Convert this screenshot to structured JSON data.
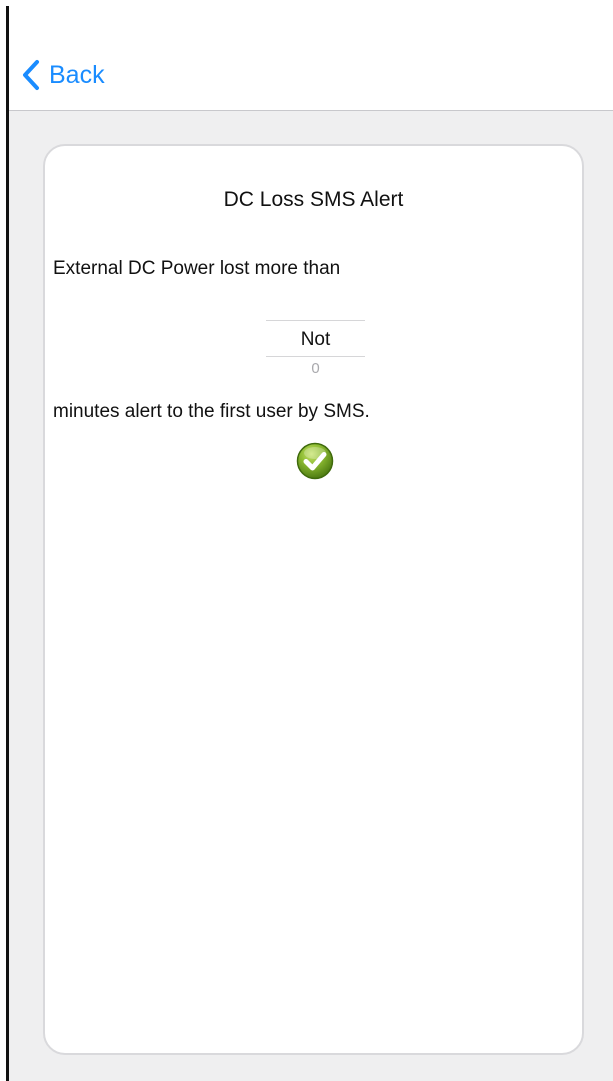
{
  "nav": {
    "back_label": "Back"
  },
  "card": {
    "title": "DC Loss SMS Alert",
    "lead_text": "External DC Power lost more than",
    "picker": {
      "selected": "Not",
      "next": "0"
    },
    "trail_text": "minutes alert to the first user by SMS."
  },
  "icons": {
    "back": "chevron-left-icon",
    "confirm": "checkmark-circle-icon"
  },
  "colors": {
    "accent": "#1a8cff",
    "background": "#efeff0",
    "confirm_green": "#6fa52a"
  }
}
